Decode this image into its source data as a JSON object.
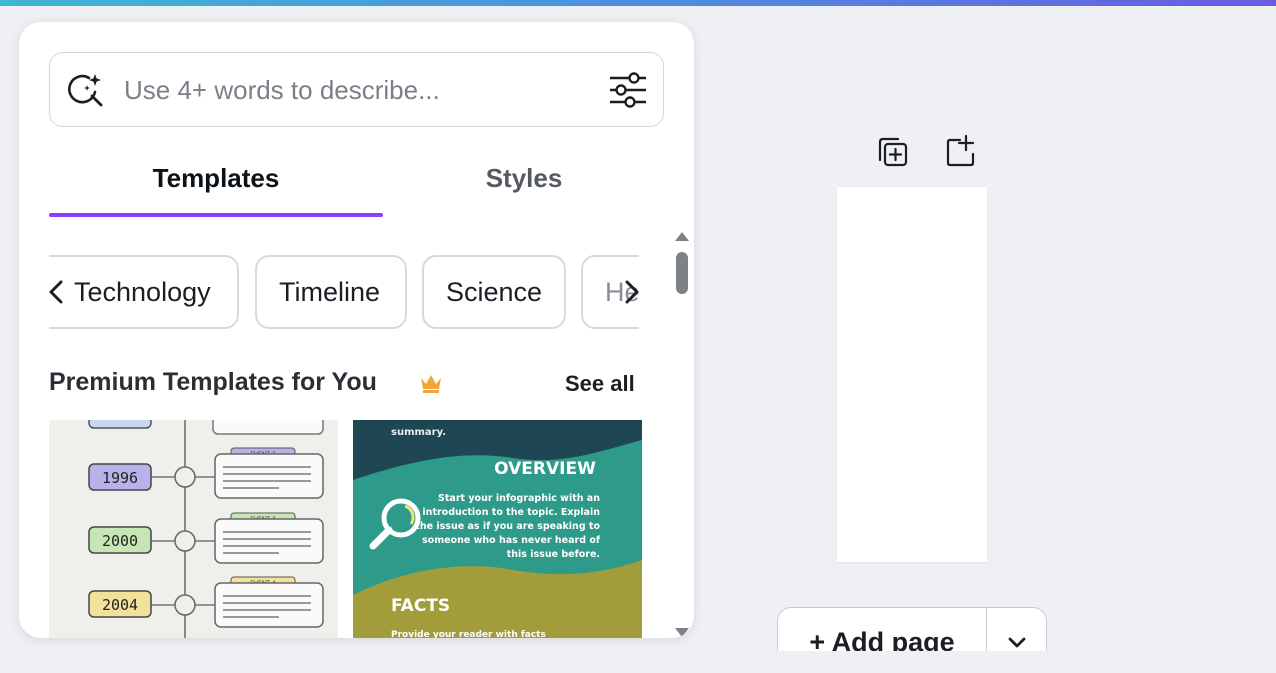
{
  "search": {
    "placeholder": "Use 4+ words to describe..."
  },
  "tabs": [
    {
      "label": "Templates",
      "active": true
    },
    {
      "label": "Styles",
      "active": false
    }
  ],
  "chips": [
    "Technology",
    "Timeline",
    "Science",
    "He"
  ],
  "section": {
    "title": "Premium Templates for You",
    "see_all": "See all"
  },
  "thumb1": {
    "years": [
      "1996",
      "2000",
      "2004"
    ],
    "events": [
      "EVENT 2",
      "EVENT 3",
      "EVENT 4"
    ]
  },
  "thumb2": {
    "summary": "summary.",
    "overview_title": "OVERVIEW",
    "overview_lines": [
      "Start your infographic with an",
      "introduction to the topic. Explain",
      "the issue as if you are speaking to",
      "someone who has never heard of",
      "this issue before."
    ],
    "facts_title": "FACTS",
    "facts_line": "Provide your reader with facts"
  },
  "add_page": {
    "label": "+ Add page"
  },
  "colors": {
    "accent": "#8b3dff",
    "background": "#eff0f4",
    "crown": "#f0a63a"
  },
  "icons": {
    "search": "magic-search-icon",
    "filter": "sliders-icon",
    "duplicate": "duplicate-page-icon",
    "add_page": "add-page-icon",
    "dropdown": "chevron-down-icon"
  }
}
